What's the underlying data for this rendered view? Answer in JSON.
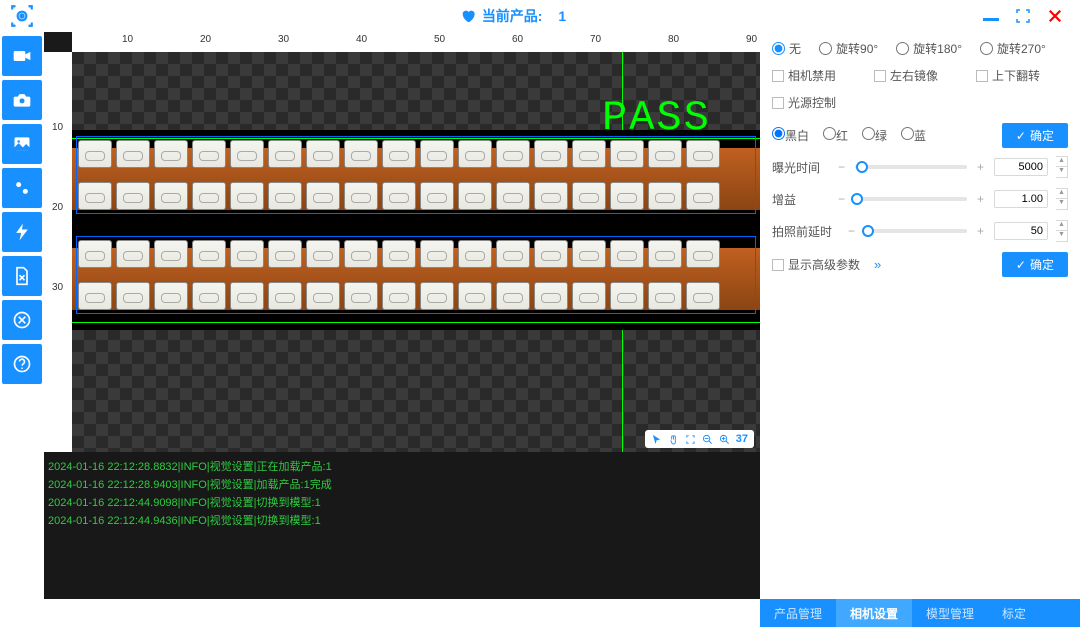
{
  "header": {
    "heart_label": "当前产品:",
    "product_index": "1"
  },
  "sidebar_icons": [
    "video",
    "camera",
    "image",
    "gear",
    "flash",
    "file-x",
    "close-circle",
    "help"
  ],
  "viewer": {
    "ruler_top": [
      "10",
      "20",
      "30",
      "40",
      "50",
      "60",
      "70",
      "80",
      "90"
    ],
    "ruler_left": [
      "10",
      "20",
      "30"
    ],
    "pass_text": "PASS",
    "tool_number": "37"
  },
  "log": [
    "2024-01-16 22:12:28.8832|INFO|视觉设置|正在加载产品:1",
    "2024-01-16 22:12:28.9403|INFO|视觉设置|加载产品:1完成",
    "2024-01-16 22:12:44.9098|INFO|视觉设置|切换到模型:1",
    "2024-01-16 22:12:44.9436|INFO|视觉设置|切换到模型:1"
  ],
  "panel": {
    "rotation": {
      "none": "无",
      "r90": "旋转90°",
      "r180": "旋转180°",
      "r270": "旋转270°",
      "selected": "none"
    },
    "disable_camera": "相机禁用",
    "mirror_lr": "左右镜像",
    "flip_ud": "上下翻转",
    "light_control": "光源控制",
    "color": {
      "bw": "黑白",
      "red": "红",
      "green": "绿",
      "blue": "蓝",
      "selected": "bw"
    },
    "confirm": "确定",
    "exposure": {
      "label": "曝光时间",
      "value": "5000"
    },
    "gain": {
      "label": "增益",
      "value": "1.00"
    },
    "delay": {
      "label": "拍照前延时",
      "value": "50"
    },
    "show_advanced": "显示高级参数"
  },
  "footer": {
    "product_mgmt": "产品管理",
    "camera_settings": "相机设置",
    "model_mgmt": "模型管理",
    "calibration": "标定",
    "active": "camera_settings"
  }
}
